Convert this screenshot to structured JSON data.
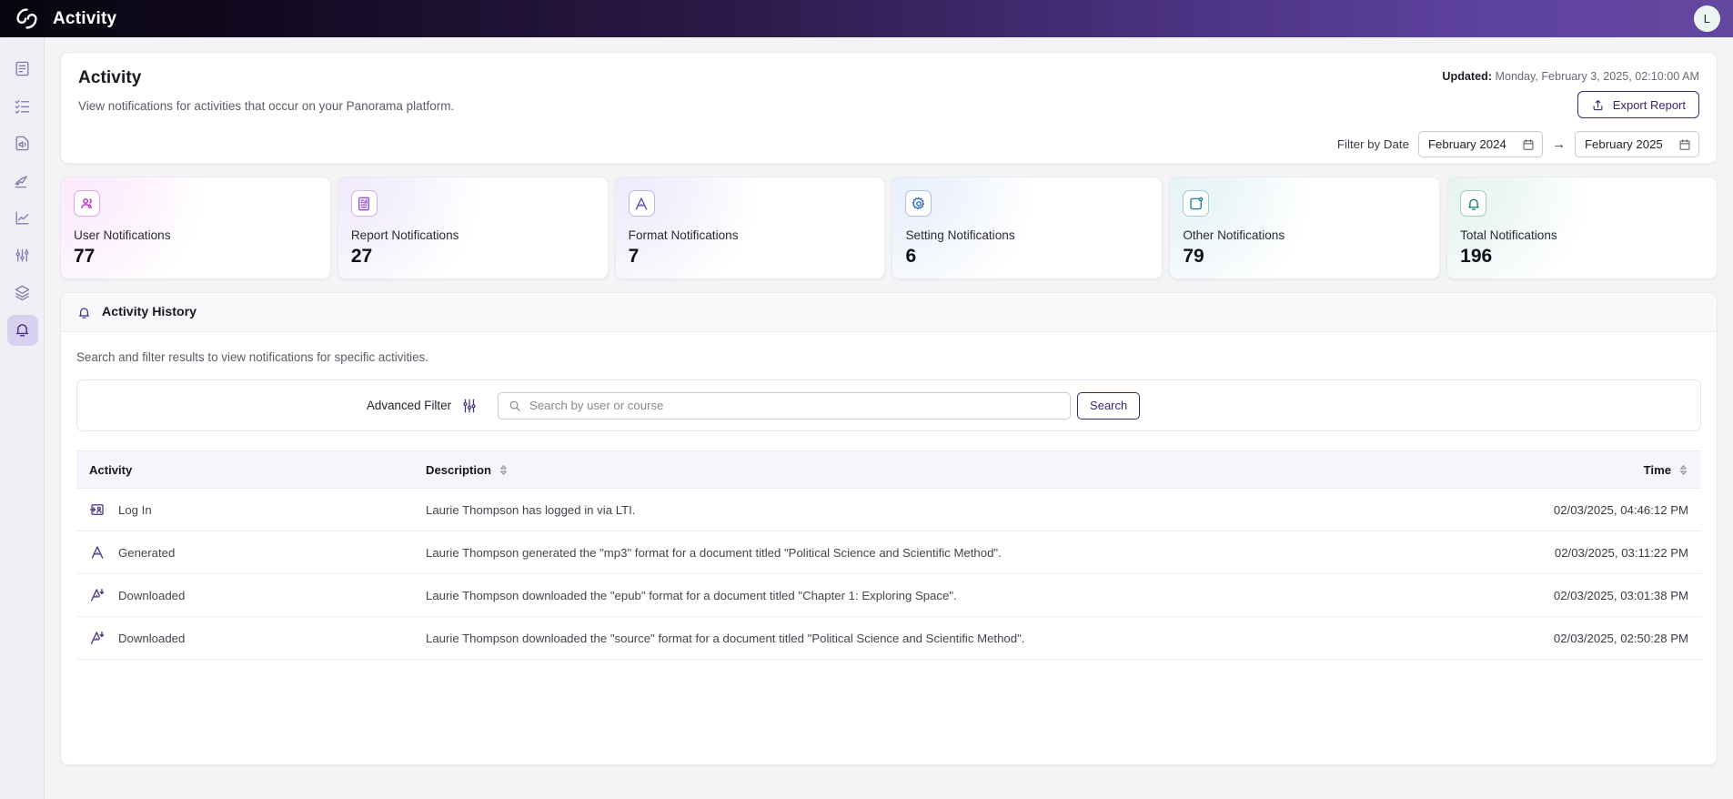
{
  "topbar": {
    "title": "Activity",
    "avatar_initial": "L",
    "logo": "spiral-logo"
  },
  "sidebar": {
    "items": [
      {
        "name": "sidebar-item-document",
        "icon": "document-icon",
        "active": false
      },
      {
        "name": "sidebar-item-checklist",
        "icon": "checklist-icon",
        "active": false
      },
      {
        "name": "sidebar-item-audio-document",
        "icon": "audio-document-icon",
        "active": false
      },
      {
        "name": "sidebar-item-publish",
        "icon": "paper-plane-icon",
        "active": false
      },
      {
        "name": "sidebar-item-analytics",
        "icon": "line-chart-icon",
        "active": false
      },
      {
        "name": "sidebar-item-settings",
        "icon": "sliders-icon",
        "active": false
      },
      {
        "name": "sidebar-item-layers",
        "icon": "layers-icon",
        "active": false
      },
      {
        "name": "sidebar-item-notifications",
        "icon": "bell-icon",
        "active": true
      }
    ]
  },
  "hero": {
    "title": "Activity",
    "subtitle": "View notifications for activities that occur on your Panorama platform.",
    "updated_label": "Updated:",
    "updated_value": "Monday, February 3, 2025, 02:10:00 AM",
    "export_label": "Export Report",
    "filter_label": "Filter by Date",
    "date_from": "February 2024",
    "date_to": "February 2025",
    "arrow": "→"
  },
  "stats": [
    {
      "label": "User Notifications",
      "value": "77",
      "icon": "users-icon",
      "color": "#c21ecb",
      "wash": "#fbeafd"
    },
    {
      "label": "Report Notifications",
      "value": "27",
      "icon": "report-icon",
      "color": "#8b3fd6",
      "wash": "#f1ebfb"
    },
    {
      "label": "Format Notifications",
      "value": "7",
      "icon": "format-a-icon",
      "color": "#5b41c4",
      "wash": "#eeecfb"
    },
    {
      "label": "Setting Notifications",
      "value": "6",
      "icon": "gear-icon",
      "color": "#2563c9",
      "wash": "#e9f0fb"
    },
    {
      "label": "Other Notifications",
      "value": "79",
      "icon": "other-icon",
      "color": "#0f7f92",
      "wash": "#e6f3f6"
    },
    {
      "label": "Total Notifications",
      "value": "196",
      "icon": "bell-icon",
      "color": "#0e7d70",
      "wash": "#e6f4f1"
    }
  ],
  "panel": {
    "title": "Activity History",
    "subtitle": "Search and filter results to view notifications for specific activities.",
    "advanced_filter_label": "Advanced Filter",
    "search_placeholder": "Search by user or course",
    "search_value": "",
    "search_button": "Search"
  },
  "table": {
    "columns": [
      {
        "key": "activity",
        "label": "Activity",
        "sortable": false
      },
      {
        "key": "description",
        "label": "Description",
        "sortable": true
      },
      {
        "key": "time",
        "label": "Time",
        "sortable": true
      }
    ],
    "rows": [
      {
        "icon": "login-icon",
        "activity": "Log In",
        "description": "Laurie Thompson has logged in via LTI.",
        "time": "02/03/2025, 04:46:12 PM"
      },
      {
        "icon": "format-a-icon",
        "activity": "Generated",
        "description": "Laurie Thompson generated the \"mp3\" format for a document titled \"Political Science and Scientific Method\".",
        "time": "02/03/2025, 03:11:22 PM"
      },
      {
        "icon": "download-a-icon",
        "activity": "Downloaded",
        "description": "Laurie Thompson downloaded the \"epub\" format for a document titled \"Chapter 1: Exploring Space\".",
        "time": "02/03/2025, 03:01:38 PM"
      },
      {
        "icon": "download-a-icon",
        "activity": "Downloaded",
        "description": "Laurie Thompson downloaded the \"source\" format for a document titled \"Political Science and Scientific Method\".",
        "time": "02/03/2025, 02:50:28 PM"
      }
    ]
  },
  "colors": {
    "brand_purple": "#3f2471",
    "header_gradient_start": "#07060f",
    "header_gradient_end": "#63479f"
  }
}
